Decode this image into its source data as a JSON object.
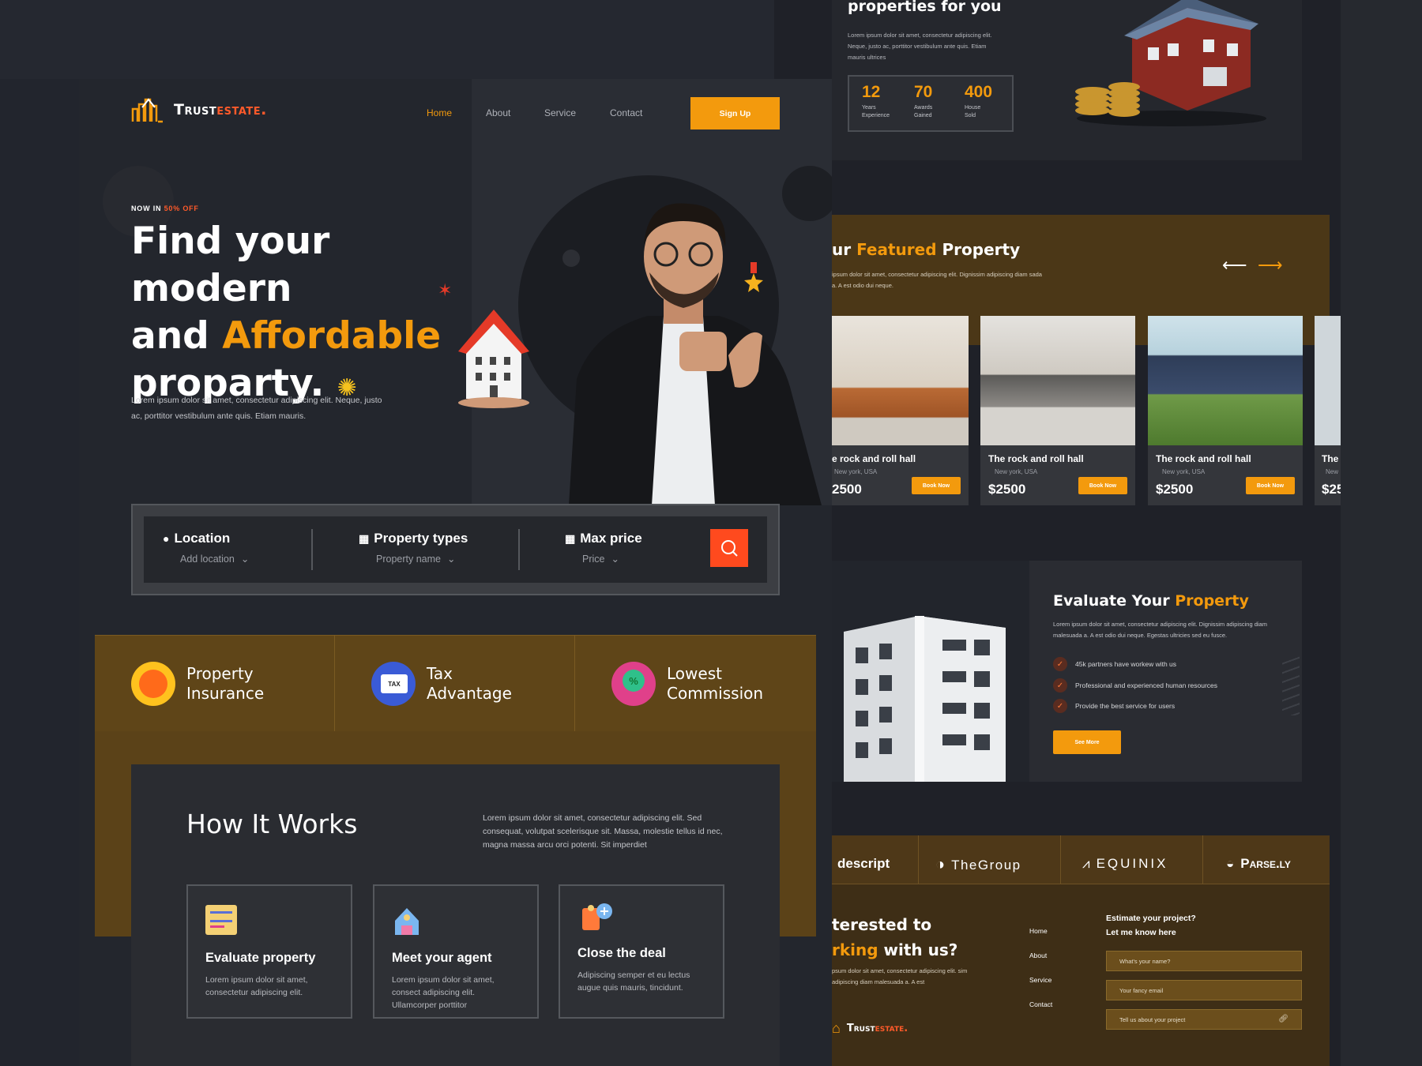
{
  "brand": {
    "name_part1": "Trust",
    "name_part2": "estate."
  },
  "nav": {
    "items": [
      "Home",
      "About",
      "Service",
      "Contact"
    ],
    "signup": "Sign Up"
  },
  "hero": {
    "badge_prefix": "NOW IN ",
    "badge_offer": "50% OFF",
    "title_line1": "Find your modern",
    "title_and": "and ",
    "title_accent": "Affordable",
    "title_line3": "proparty.",
    "description": "Lorem ipsum dolor sit amet, consectetur adipiscing elit. Neque, justo ac, porttitor vestibulum ante quis. Etiam mauris."
  },
  "search": {
    "location_label": "Location",
    "location_placeholder": "Add location",
    "types_label": "Property types",
    "types_placeholder": "Property name",
    "price_label": "Max price",
    "price_placeholder": "Price"
  },
  "features": [
    {
      "line1": "Property",
      "line2": "Insurance"
    },
    {
      "line1": "Tax",
      "line2": "Advantage"
    },
    {
      "line1": "Lowest",
      "line2": "Commission"
    }
  ],
  "how": {
    "title": "How It Works",
    "description": "Lorem ipsum dolor sit amet, consectetur adipiscing elit. Sed consequat, volutpat scelerisque sit. Massa, molestie tellus id nec, magna massa arcu orci potenti. Sit imperdiet",
    "steps": [
      {
        "title": "Evaluate property",
        "desc": "Lorem ipsum dolor sit amet, consectetur adipiscing elit."
      },
      {
        "title": "Meet your agent",
        "desc": "Lorem ipsum dolor sit amet, consect adipiscing elit. Ullamcorper porttitor"
      },
      {
        "title": "Close the deal",
        "desc": "Adipiscing semper et eu lectus augue quis mauris, tincidunt."
      }
    ]
  },
  "about": {
    "title": "properties for you",
    "description": "Lorem ipsum dolor sit amet, consectetur adipiscing elit. Neque, justo ac, porttitor vestibulum ante quis. Etiam mauris ultrices",
    "stats": [
      {
        "value": "12",
        "l1": "Years",
        "l2": "Experience"
      },
      {
        "value": "70",
        "l1": "Awards",
        "l2": "Gained"
      },
      {
        "value": "400",
        "l1": "House",
        "l2": "Sold"
      }
    ]
  },
  "featured": {
    "title_prefix": "ur ",
    "title_accent": "Featured",
    "title_suffix": " Property",
    "description": "ipsum dolor sit amet, consectetur adipiscing elit. Dignissim adipiscing diam sada a. A est odio dui neque.",
    "cards": [
      {
        "name": "e rock and roll hall",
        "loc": "New york, USA",
        "price": "2500",
        "btn": "Book Now"
      },
      {
        "name": "The rock and roll hall",
        "loc": "New york, USA",
        "price": "$2500",
        "btn": "Book Now"
      },
      {
        "name": "The rock and roll hall",
        "loc": "New york, USA",
        "price": "$2500",
        "btn": "Book Now"
      },
      {
        "name": "The",
        "loc": "New",
        "price": "$25",
        "btn": ""
      }
    ]
  },
  "evaluate": {
    "title": "Evaluate Your ",
    "title_accent": "Property",
    "description": "Lorem ipsum dolor sit amet, consectetur adipiscing elit. Dignissim adipiscing diam malesuada a. A est odio dui neque. Egestas ultricies sed eu fusce.",
    "checks": [
      "45k partners have workew with us",
      "Professional and experienced human resources",
      "Provide the best service for users"
    ],
    "button": "See More"
  },
  "brands": [
    "descript",
    "TheGroup",
    "EQUINIX",
    "Parse.ly"
  ],
  "contact": {
    "title_l1": "terested to",
    "title_accent": "rking",
    "title_l2_rest": " with us?",
    "description": "psum dolor sit amet, consectetur adipiscing elit. sim adipiscing diam malesuada a. A est",
    "footer_nav": [
      "Home",
      "About",
      "Service",
      "Contact"
    ],
    "form_title_l1": "Estimate your project?",
    "form_title_l2": "Let me know here",
    "name_placeholder": "What's your name?",
    "email_placeholder": "Your fancy email",
    "project_placeholder": "Tell us about your project"
  },
  "colors": {
    "accent": "#f39a0d",
    "red": "#ff5a2a",
    "bg": "#22252d",
    "brown": "#5f4518"
  }
}
